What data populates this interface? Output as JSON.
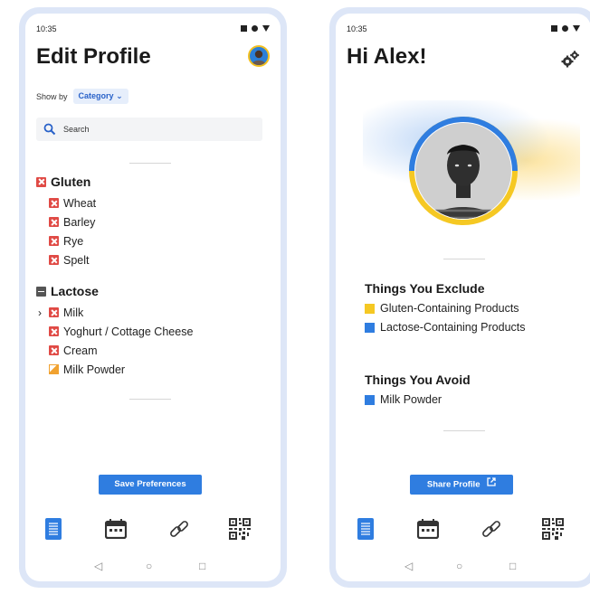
{
  "left": {
    "status": {
      "time": "10:35"
    },
    "title": "Edit Profile",
    "show_by": {
      "label": "Show by",
      "value": "Category"
    },
    "search": {
      "placeholder": "Search"
    },
    "groups": [
      {
        "name": "Gluten",
        "items": [
          "Wheat",
          "Barley",
          "Rye",
          "Spelt"
        ]
      },
      {
        "name": "Lactose",
        "items": [
          "Milk",
          "Yoghurt / Cottage Cheese",
          "Cream",
          "Milk Powder"
        ]
      }
    ],
    "save_button": "Save Preferences"
  },
  "right": {
    "status": {
      "time": "10:35"
    },
    "title": "Hi Alex!",
    "exclude": {
      "title": "Things You Exclude",
      "items": [
        {
          "label": "Gluten-Containing Products",
          "color": "#f5c823"
        },
        {
          "label": "Lactose-Containing Products",
          "color": "#2f7de0"
        }
      ]
    },
    "avoid": {
      "title": "Things You Avoid",
      "items": [
        {
          "label": "Milk Powder",
          "color": "#2f7de0"
        }
      ]
    },
    "share_button": "Share Profile"
  },
  "tabs": [
    "document-icon",
    "calendar-icon",
    "link-icon",
    "qr-code-icon"
  ],
  "nav": [
    "back-icon",
    "home-icon",
    "recents-icon"
  ],
  "colors": {
    "accent": "#2f7de0",
    "excluded": "#e04a45",
    "partial": "#f1a230",
    "yellow": "#f5c823"
  }
}
